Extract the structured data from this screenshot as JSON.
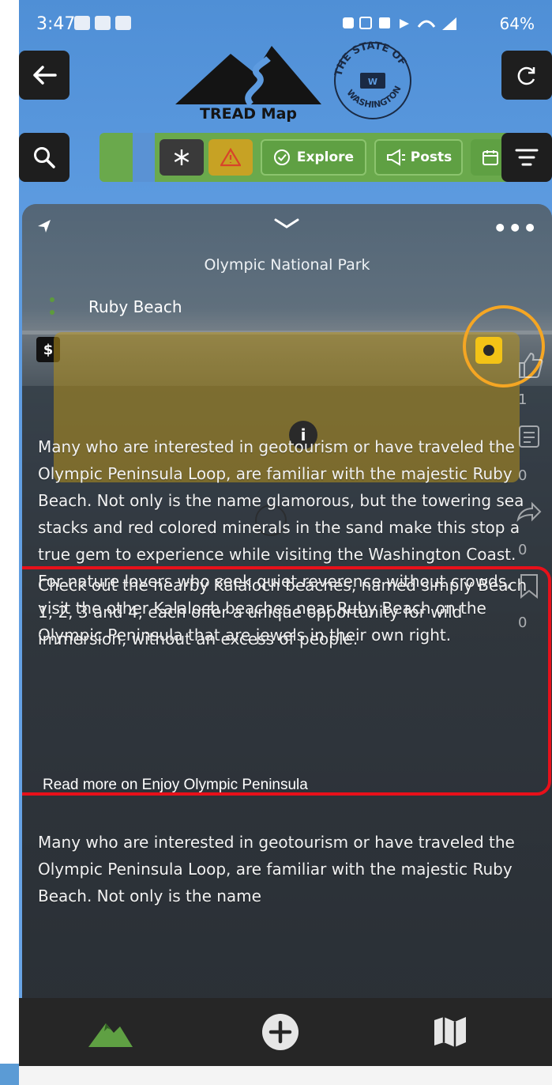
{
  "status_bar": {
    "time": "3:47",
    "battery": "64%"
  },
  "header": {
    "app_name": "TREAD Map",
    "seal_text": "THE STATE OF WASHINGTON"
  },
  "categories": {
    "explore": "Explore",
    "posts": "Posts"
  },
  "detail": {
    "park_name": "Olympic National Park",
    "place_name": "Ruby Beach",
    "price_label": "$",
    "paragraphs": [
      "Many who are interested in geotourism or have traveled the Olympic Peninsula Loop, are familiar with the majestic Ruby Beach. Not only is the name glamorous, but the towering sea stacks and red colored minerals in the sand make this stop a true gem to experience while visiting the Washington Coast. For nature lovers who seek quiet reverence without crowds, visit the other Kalaloch beaches near Ruby Beach on the Olympic Peninsula that are jewels in their own right.",
      "Check out the nearby Kalaloch beaches, named simply Beach 1, 2, 3 and 4, each offer a unique opportunity for wild immersion, without an excess of people.",
      "Many who are interested in geotourism or have traveled the Olympic Peninsula Loop, are familiar with the majestic Ruby Beach. Not only is the name"
    ],
    "read_more": "Read more on Enjoy Olympic Peninsula",
    "side_counts": [
      "1",
      "0",
      "0",
      "0"
    ]
  },
  "icons": [
    "back-arrow-icon",
    "refresh-icon",
    "search-icon",
    "filter-icon",
    "snowflake-icon",
    "warning-icon",
    "check-circle-icon",
    "megaphone-icon",
    "calendar-icon",
    "navigation-arrow-icon",
    "chevron-down-icon",
    "more-dots-icon",
    "info-icon",
    "thumbs-up-icon",
    "comment-icon",
    "share-icon",
    "bookmark-icon",
    "mountains-icon",
    "plus-circle-icon",
    "map-icon"
  ],
  "colors": {
    "accent_green": "#6aa94c",
    "highlight_orange": "#f5a623",
    "highlight_red": "#e8101a",
    "info_yellow": "#f3c316",
    "sky_blue": "#5d9be0"
  }
}
